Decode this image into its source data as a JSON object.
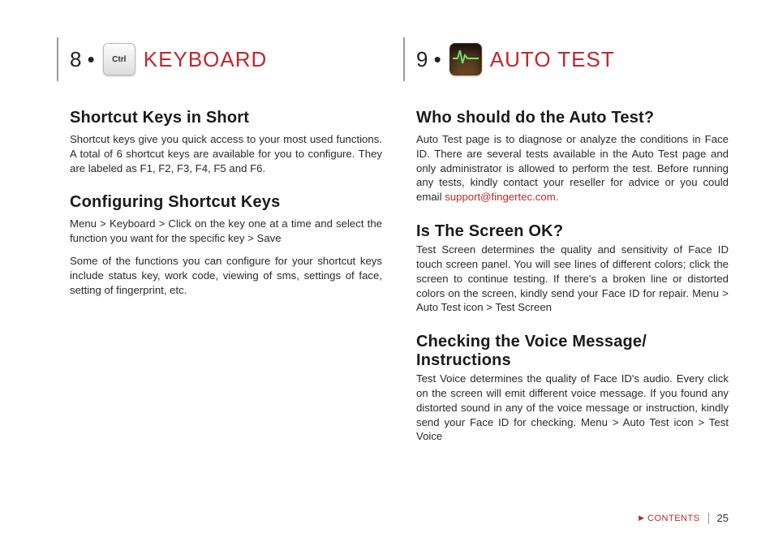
{
  "left": {
    "chapter_number": "8 •",
    "chapter_title": "KEYBOARD",
    "icon_label": "Ctrl",
    "sections": [
      {
        "heading": "Shortcut Keys in Short",
        "body": "Shortcut keys give you quick access to your most used functions. A total of 6 shortcut keys are available for you to configure. They are labeled as F1, F2, F3, F4, F5 and F6."
      },
      {
        "heading": "Configuring Shortcut Keys",
        "body1": "Menu > Keyboard > Click on the key one at a time and select the function you want for the specific key > Save",
        "body2": "Some of the functions you can configure for your shortcut keys include status key, work code, viewing of sms, settings of face, setting of fingerprint, etc."
      }
    ]
  },
  "right": {
    "chapter_number": "9 •",
    "chapter_title": "AUTO TEST",
    "sections": [
      {
        "heading": "Who should do the Auto Test?",
        "body_pre": "Auto Test page is to diagnose or analyze the conditions in Face ID. There are several tests available in the Auto Test page and only administrator is allowed to perform the test. Before running any tests, kindly contact your reseller for advice or you could email ",
        "email": "support@fingertec.com."
      },
      {
        "heading": "Is The Screen OK?",
        "body": "Test Screen determines the quality and sensitivity of Face ID touch screen panel. You will see lines of different colors; click the screen to continue testing. If there's a broken line or distorted colors on the screen, kindly send your Face ID for repair. Menu > Auto Test icon > Test Screen"
      },
      {
        "heading": "Checking the Voice Message/ Instructions",
        "body": "Test Voice determines the quality of Face ID's audio. Every click on the screen will emit different voice message. If you found any distorted sound in any of the voice message or instruction, kindly send your Face ID for checking. Menu > Auto Test icon > Test Voice"
      }
    ]
  },
  "footer": {
    "contents_label": "CONTENTS",
    "page_number": "25"
  }
}
